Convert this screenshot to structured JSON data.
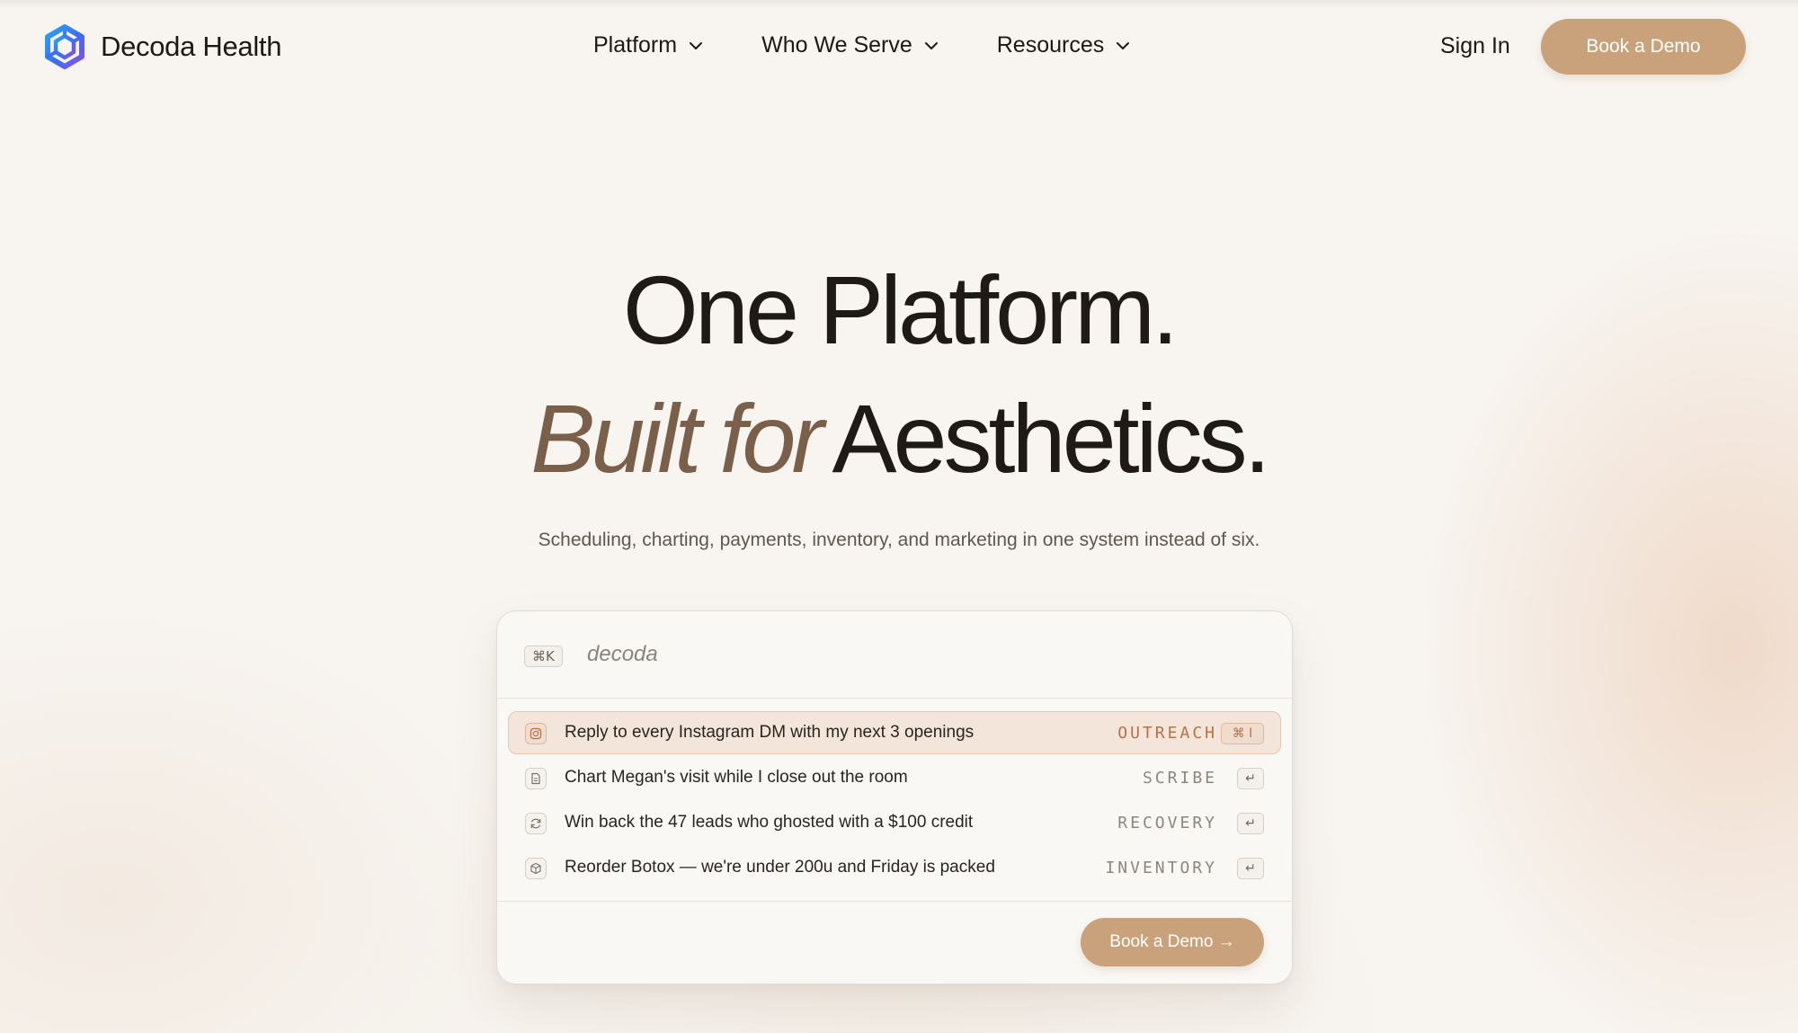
{
  "brand": {
    "name": "Decoda Health",
    "logo_icon": "hexagon-logo-icon"
  },
  "nav": {
    "items": [
      {
        "label": "Platform",
        "icon": "chevron-down-icon"
      },
      {
        "label": "Who We Serve",
        "icon": "chevron-down-icon"
      },
      {
        "label": "Resources",
        "icon": "chevron-down-icon"
      }
    ],
    "sign_in": "Sign In",
    "cta": "Book a Demo"
  },
  "hero": {
    "line1": "One Platform.",
    "line2_accent": "Built for",
    "line2_rest": "Aesthetics.",
    "subtitle": "Scheduling, charting, payments, inventory, and marketing in one system instead of six."
  },
  "palette": {
    "shortcut": "⌘K",
    "query": "decoda",
    "rows": [
      {
        "icon": "instagram-icon",
        "label": "Reply to every Instagram DM with my next 3 openings",
        "tag": "OUTREACH",
        "key": "⌘ I",
        "active": true
      },
      {
        "icon": "document-icon",
        "label": "Chart Megan's visit while I close out the room",
        "tag": "SCRIBE",
        "key": "↵",
        "active": false
      },
      {
        "icon": "refresh-icon",
        "label": "Win back the 47 leads who ghosted with a $100 credit",
        "tag": "RECOVERY",
        "key": "↵",
        "active": false
      },
      {
        "icon": "box-icon",
        "label": "Reorder Botox — we're under 200u and Friday is packed",
        "tag": "INVENTORY",
        "key": "↵",
        "active": false
      }
    ],
    "cta": "Book a Demo →"
  },
  "colors": {
    "accent": "#c9a27c",
    "accent_text": "#7a5f4b",
    "tag_active": "#b7724a",
    "background": "#f8f5f1"
  }
}
